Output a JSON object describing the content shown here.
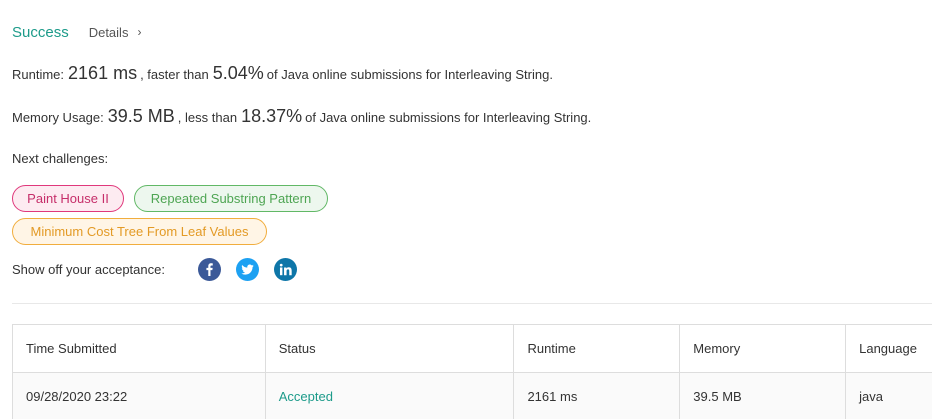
{
  "header": {
    "status": "Success",
    "details_link": "Details",
    "chevron": "›"
  },
  "runtime": {
    "label": "Runtime:",
    "value": "2161 ms",
    "comparison": ", faster than",
    "percent": "5.04%",
    "suffix": "of Java online submissions for Interleaving String."
  },
  "memory": {
    "label": "Memory Usage:",
    "value": "39.5 MB",
    "comparison": ", less than",
    "percent": "18.37%",
    "suffix": "of Java online submissions for Interleaving String."
  },
  "next_challenges": {
    "label": "Next challenges:",
    "items": [
      {
        "title": "Paint House II",
        "difficulty_color": "#e0387c"
      },
      {
        "title": "Repeated Substring Pattern",
        "difficulty_color": "#61b866"
      },
      {
        "title": "Minimum Cost Tree From Leaf Values",
        "difficulty_color": "#f1ad3d"
      }
    ]
  },
  "share": {
    "label": "Show off your acceptance:",
    "icons": [
      "facebook-icon",
      "twitter-icon",
      "linkedin-icon"
    ]
  },
  "submissions": {
    "columns": [
      "Time Submitted",
      "Status",
      "Runtime",
      "Memory",
      "Language"
    ],
    "rows": [
      {
        "time": "09/28/2020 23:22",
        "status": "Accepted",
        "runtime": "2161 ms",
        "memory": "39.5 MB",
        "language": "java"
      }
    ]
  },
  "colors": {
    "success": "#1d9b8a",
    "facebook": "#3b5998",
    "twitter": "#1da1f2",
    "linkedin": "#0e76a8"
  }
}
